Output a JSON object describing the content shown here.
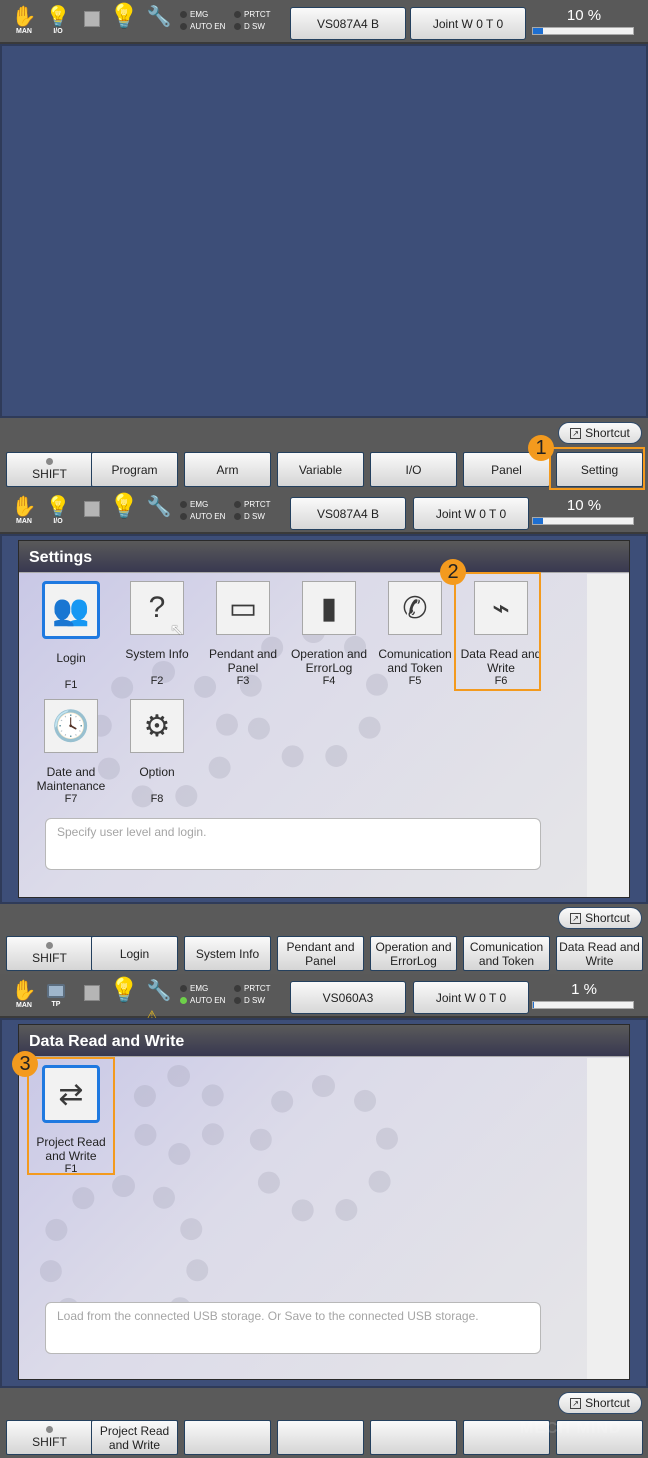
{
  "screens": [
    {
      "statusbar": {
        "mode_label": "MAN",
        "io_label": "I/O",
        "indicators": [
          {
            "label": "EMG",
            "on": false
          },
          {
            "label": "PRTCT",
            "on": false
          },
          {
            "label": "AUTO EN",
            "on": false
          },
          {
            "label": "D SW",
            "on": false
          }
        ],
        "robot_button": "VS087A4 B",
        "joint_button": "Joint  W 0 T 0",
        "speed": {
          "text": "10 %",
          "percent": 10
        }
      },
      "shortcut_label": "Shortcut",
      "function_bar": [
        "SHIFT",
        "Program",
        "Arm",
        "Variable",
        "I/O",
        "Panel",
        "Setting"
      ],
      "callout": {
        "number": "1",
        "target": "Setting"
      }
    },
    {
      "statusbar": {
        "mode_label": "MAN",
        "io_label": "I/O",
        "indicators": [
          {
            "label": "EMG",
            "on": false
          },
          {
            "label": "PRTCT",
            "on": false
          },
          {
            "label": "AUTO EN",
            "on": false
          },
          {
            "label": "D SW",
            "on": false
          }
        ],
        "robot_button": "VS087A4 B",
        "joint_button": "Joint  W 0 T 0",
        "speed": {
          "text": "10 %",
          "percent": 10
        }
      },
      "window_title": "Settings",
      "tiles": [
        {
          "icon": "login-icon",
          "glyph": "👥",
          "label": "Login",
          "fkey": "F1",
          "selected": true
        },
        {
          "icon": "system-info-icon",
          "glyph": "?",
          "label": "System Info",
          "fkey": "F2",
          "selected": false
        },
        {
          "icon": "pendant-icon",
          "glyph": "▭",
          "label": "Pendant and Panel",
          "fkey": "F3",
          "selected": false
        },
        {
          "icon": "book-icon",
          "glyph": "▮",
          "label": "Operation and ErrorLog",
          "fkey": "F4",
          "selected": false
        },
        {
          "icon": "phone-icon",
          "glyph": "✆",
          "label": "Comunication and Token",
          "fkey": "F5",
          "selected": false
        },
        {
          "icon": "usb-icon",
          "glyph": "⌁",
          "label": "Data Read and Write",
          "fkey": "F6",
          "selected": false
        },
        {
          "icon": "calendar-clock-icon",
          "glyph": "🕓",
          "label": "Date and Maintenance",
          "fkey": "F7",
          "selected": false
        },
        {
          "icon": "gears-icon",
          "glyph": "⚙",
          "label": "Option",
          "fkey": "F8",
          "selected": false
        }
      ],
      "description": "Specify user level and login.",
      "shortcut_label": "Shortcut",
      "function_bar": [
        "SHIFT",
        "Login",
        "System Info",
        "Pendant and Panel",
        "Operation and ErrorLog",
        "Comunication and Token",
        "Data Read and Write"
      ],
      "callout": {
        "number": "2",
        "target": "Data Read and Write"
      }
    },
    {
      "statusbar": {
        "mode_label": "MAN",
        "io_label": "TP",
        "indicators": [
          {
            "label": "EMG",
            "on": false
          },
          {
            "label": "PRTCT",
            "on": false
          },
          {
            "label": "AUTO EN",
            "on": true
          },
          {
            "label": "D SW",
            "on": false
          }
        ],
        "robot_button": "VS060A3",
        "joint_button": "Joint  W 0 T 0",
        "speed": {
          "text": "1 %",
          "percent": 1
        }
      },
      "window_title": "Data Read and Write",
      "tiles": [
        {
          "icon": "project-usb-icon",
          "glyph": "⇄",
          "label": "Project Read and Write",
          "fkey": "F1",
          "selected": true
        }
      ],
      "description": "Load from the connected USB storage. Or Save to the connected USB storage.",
      "shortcut_label": "Shortcut",
      "function_bar": [
        "SHIFT",
        "Project Read and Write",
        "",
        "",
        "",
        "",
        ""
      ],
      "callout": {
        "number": "3",
        "target": "Project Read and Write"
      }
    }
  ],
  "watermark": "MECH MIND"
}
